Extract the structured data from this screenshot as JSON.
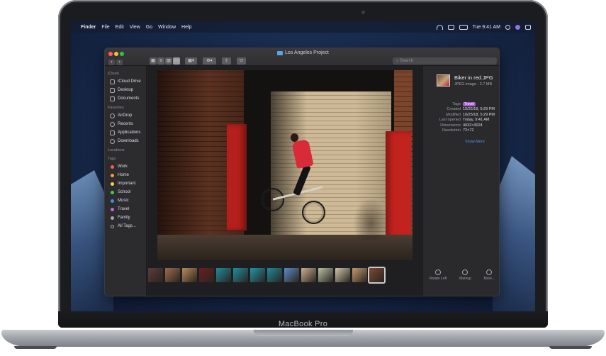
{
  "device": {
    "brand": "MacBook Pro"
  },
  "menubar": {
    "app": "Finder",
    "items": [
      "File",
      "Edit",
      "View",
      "Go",
      "Window",
      "Help"
    ],
    "clock": "Tue 9:41 AM"
  },
  "window": {
    "title": "Los Angeles Project",
    "search_placeholder": "Search",
    "nav_back": "‹",
    "nav_forward": "›"
  },
  "sidebar": {
    "sections": {
      "icloud": "iCloud",
      "favorites": "Favorites",
      "locations": "Locations",
      "tags": "Tags"
    },
    "icloud_items": [
      "iCloud Drive",
      "Desktop",
      "Documents"
    ],
    "favorite_items": [
      "AirDrop",
      "Recents",
      "Applications",
      "Downloads"
    ],
    "tags": [
      {
        "label": "Work",
        "color": "#ff5b5b"
      },
      {
        "label": "Home",
        "color": "#ff9a2e"
      },
      {
        "label": "Important",
        "color": "#f2d43a"
      },
      {
        "label": "School",
        "color": "#3ecb5a"
      },
      {
        "label": "Music",
        "color": "#3a8ff0"
      },
      {
        "label": "Travel",
        "color": "#b76be0"
      },
      {
        "label": "Family",
        "color": "#a7a8ad"
      },
      {
        "label": "All Tags...",
        "color": ""
      }
    ]
  },
  "inspector": {
    "file_name": "Biker in red.JPG",
    "file_kind": "JPEG image - 2.7 MB",
    "meta": [
      {
        "label": "Tags",
        "value": "Travel"
      },
      {
        "label": "Created",
        "value": "10/25/18, 5:29 PM"
      },
      {
        "label": "Modified",
        "value": "10/25/18, 5:29 PM"
      },
      {
        "label": "Last opened",
        "value": "Today, 9:41 AM"
      },
      {
        "label": "Dimensions",
        "value": "4032×3024"
      },
      {
        "label": "Resolution",
        "value": "72×72"
      }
    ],
    "show_more": "Show More",
    "actions": [
      "Rotate Left",
      "Markup",
      "More..."
    ],
    "tag_color": "#a259c9"
  },
  "filmstrip": {
    "selected_index": 13,
    "thumb_colors": [
      "#5a3d3a",
      "#9e6b4c",
      "#b88a5a",
      "#6a1f22",
      "#1f8c9b",
      "#1e8fa0",
      "#2295a6",
      "#1c8b9c",
      "#5b8cc4",
      "#c9b08e",
      "#b7c2a0",
      "#d2c6a8",
      "#c49a6c",
      "#7b4a33"
    ]
  }
}
